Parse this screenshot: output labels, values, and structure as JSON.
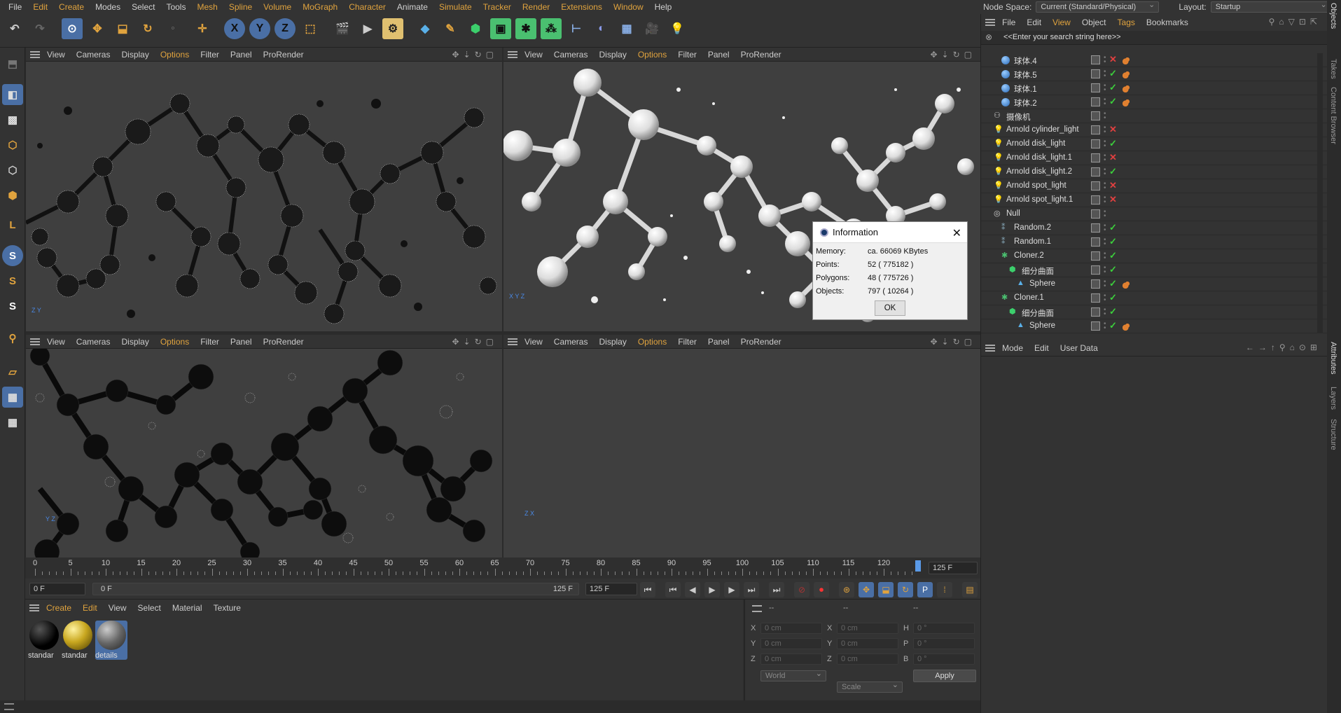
{
  "menu": [
    "File",
    "Edit",
    "Create",
    "Modes",
    "Select",
    "Tools",
    "Mesh",
    "Spline",
    "Volume",
    "MoGraph",
    "Character",
    "Animate",
    "Simulate",
    "Tracker",
    "Render",
    "Extensions",
    "Window",
    "Help"
  ],
  "node_space": {
    "label": "Node Space:",
    "value": "Current (Standard/Physical)"
  },
  "layout": {
    "label": "Layout:",
    "value": "Startup"
  },
  "viewport_menu": [
    "View",
    "Cameras",
    "Display",
    "Options",
    "Filter",
    "Panel",
    "ProRender"
  ],
  "viewports": [
    {
      "id": "top-left",
      "axes": "Z Y"
    },
    {
      "id": "top-right",
      "axes": "X Y Z"
    },
    {
      "id": "bottom-left",
      "axes": "Y Z"
    },
    {
      "id": "bottom-right",
      "axes": "Z X"
    }
  ],
  "dialog": {
    "title": "Information",
    "rows": [
      {
        "label": "Memory:",
        "value": "ca. 66069 KBytes"
      },
      {
        "label": "Points:",
        "value": "52 ( 775182 )"
      },
      {
        "label": "Polygons:",
        "value": "48 ( 775726 )"
      },
      {
        "label": "Objects:",
        "value": "797 ( 10264 )"
      }
    ],
    "ok": "OK"
  },
  "timeline": {
    "ticks": [
      "0",
      "5",
      "10",
      "15",
      "20",
      "25",
      "30",
      "35",
      "40",
      "45",
      "50",
      "55",
      "60",
      "65",
      "70",
      "75",
      "80",
      "85",
      "90",
      "95",
      "100",
      "105",
      "110",
      "115",
      "120"
    ],
    "end_field": "125 F",
    "current_field": "0 F",
    "range_start": "0 F",
    "range_end": "125 F",
    "max_field": "125 F"
  },
  "material_menu": [
    "Create",
    "Edit",
    "View",
    "Select",
    "Material",
    "Texture"
  ],
  "materials": [
    {
      "name": "standar",
      "color": "#1a1a1a"
    },
    {
      "name": "standar",
      "color": "#c9a820"
    },
    {
      "name": "details",
      "color": "#666666"
    }
  ],
  "coords": {
    "headers": [
      "--",
      "--",
      "--"
    ],
    "rows": [
      {
        "a": "X",
        "av": "0 cm",
        "b": "X",
        "bv": "0 cm",
        "c": "H",
        "cv": "0 °"
      },
      {
        "a": "Y",
        "av": "0 cm",
        "b": "Y",
        "bv": "0 cm",
        "c": "P",
        "cv": "0 °"
      },
      {
        "a": "Z",
        "av": "0 cm",
        "b": "Z",
        "bv": "0 cm",
        "c": "B",
        "cv": "0 °"
      }
    ],
    "world": "World",
    "scale": "Scale",
    "apply": "Apply"
  },
  "object_menu": [
    "File",
    "Edit",
    "View",
    "Object",
    "Tags",
    "Bookmarks"
  ],
  "object_search_placeholder": "<<Enter your search string here>>",
  "objects": [
    {
      "name": "球体.4",
      "indent": 1,
      "icon": "sphere",
      "status": "x"
    },
    {
      "name": "球体.5",
      "indent": 1,
      "icon": "sphere",
      "status": "ok"
    },
    {
      "name": "球体.1",
      "indent": 1,
      "icon": "sphere",
      "status": "ok"
    },
    {
      "name": "球体.2",
      "indent": 1,
      "icon": "sphere",
      "status": "ok"
    },
    {
      "name": "摄像机",
      "indent": 0,
      "icon": "camera",
      "status": "none"
    },
    {
      "name": "Arnold cylinder_light",
      "indent": 0,
      "icon": "light",
      "status": "x"
    },
    {
      "name": "Arnold disk_light",
      "indent": 0,
      "icon": "light",
      "status": "ok"
    },
    {
      "name": "Arnold disk_light.1",
      "indent": 0,
      "icon": "light",
      "status": "x"
    },
    {
      "name": "Arnold disk_light.2",
      "indent": 0,
      "icon": "light",
      "status": "ok"
    },
    {
      "name": "Arnold spot_light",
      "indent": 0,
      "icon": "light",
      "status": "x"
    },
    {
      "name": "Arnold spot_light.1",
      "indent": 0,
      "icon": "light",
      "status": "x"
    },
    {
      "name": "Null",
      "indent": 0,
      "icon": "null",
      "status": "none"
    },
    {
      "name": "Random.2",
      "indent": 1,
      "icon": "random",
      "status": "ok"
    },
    {
      "name": "Random.1",
      "indent": 1,
      "icon": "random",
      "status": "ok"
    },
    {
      "name": "Cloner.2",
      "indent": 1,
      "icon": "cloner",
      "status": "ok"
    },
    {
      "name": "细分曲面",
      "indent": 2,
      "icon": "subdiv",
      "status": "ok"
    },
    {
      "name": "Sphere",
      "indent": 3,
      "icon": "primitive",
      "status": "ok"
    },
    {
      "name": "Cloner.1",
      "indent": 1,
      "icon": "cloner",
      "status": "ok"
    },
    {
      "name": "细分曲面",
      "indent": 2,
      "icon": "subdiv",
      "status": "ok"
    },
    {
      "name": "Sphere",
      "indent": 3,
      "icon": "primitive",
      "status": "ok"
    }
  ],
  "attr_menu": [
    "Mode",
    "Edit",
    "User Data"
  ],
  "side_tabs": [
    "Objects",
    "Takes",
    "Content Browser",
    "Attributes",
    "Layers",
    "Structure"
  ]
}
